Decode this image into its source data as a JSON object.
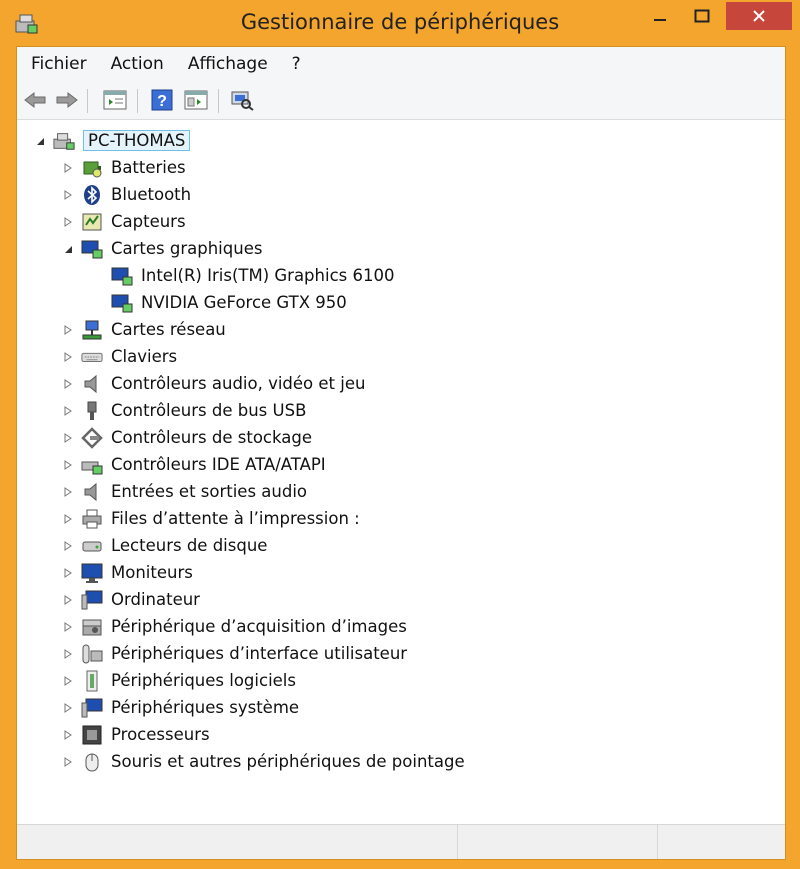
{
  "window": {
    "title": "Gestionnaire de périphériques"
  },
  "menu": {
    "items": [
      "Fichier",
      "Action",
      "Affichage",
      "?"
    ]
  },
  "toolbar": {
    "buttons": [
      "back-icon",
      "forward-icon",
      "properties-pane-icon",
      "help-icon",
      "view-pane-icon",
      "scan-hardware-icon"
    ]
  },
  "tree": {
    "root": {
      "label": "PC-THOMAS",
      "icon": "computer-icon",
      "expanded": true
    },
    "categories": [
      {
        "label": "Batteries",
        "icon": "battery-icon",
        "expanded": false
      },
      {
        "label": "Bluetooth",
        "icon": "bluetooth-icon",
        "expanded": false
      },
      {
        "label": "Capteurs",
        "icon": "sensor-icon",
        "expanded": false
      },
      {
        "label": "Cartes graphiques",
        "icon": "display-adapter-icon",
        "expanded": true,
        "children": [
          {
            "label": "Intel(R) Iris(TM) Graphics 6100",
            "icon": "display-adapter-icon"
          },
          {
            "label": "NVIDIA GeForce GTX 950",
            "icon": "display-adapter-icon"
          }
        ]
      },
      {
        "label": "Cartes réseau",
        "icon": "network-icon",
        "expanded": false
      },
      {
        "label": "Claviers",
        "icon": "keyboard-icon",
        "expanded": false
      },
      {
        "label": "Contrôleurs audio, vidéo et jeu",
        "icon": "speaker-icon",
        "expanded": false
      },
      {
        "label": "Contrôleurs de bus USB",
        "icon": "usb-icon",
        "expanded": false
      },
      {
        "label": "Contrôleurs de stockage",
        "icon": "storage-icon",
        "expanded": false
      },
      {
        "label": "Contrôleurs IDE ATA/ATAPI",
        "icon": "ide-icon",
        "expanded": false
      },
      {
        "label": "Entrées et sorties audio",
        "icon": "speaker-icon",
        "expanded": false
      },
      {
        "label": "Files d’attente à l’impression :",
        "icon": "printer-icon",
        "expanded": false
      },
      {
        "label": "Lecteurs de disque",
        "icon": "disk-icon",
        "expanded": false
      },
      {
        "label": "Moniteurs",
        "icon": "monitor-icon",
        "expanded": false
      },
      {
        "label": "Ordinateur",
        "icon": "computer-icon",
        "expanded": false
      },
      {
        "label": "Périphérique d’acquisition d’images",
        "icon": "camera-icon",
        "expanded": false
      },
      {
        "label": "Périphériques d’interface utilisateur",
        "icon": "hid-icon",
        "expanded": false
      },
      {
        "label": "Périphériques logiciels",
        "icon": "software-device-icon",
        "expanded": false
      },
      {
        "label": "Périphériques système",
        "icon": "system-device-icon",
        "expanded": false
      },
      {
        "label": "Processeurs",
        "icon": "cpu-icon",
        "expanded": false
      },
      {
        "label": "Souris et autres périphériques de pointage",
        "icon": "mouse-icon",
        "expanded": false
      }
    ]
  },
  "colors": {
    "frame": "#f3a52e",
    "close_button": "#c7463c",
    "selection": "#e5f3fb"
  }
}
